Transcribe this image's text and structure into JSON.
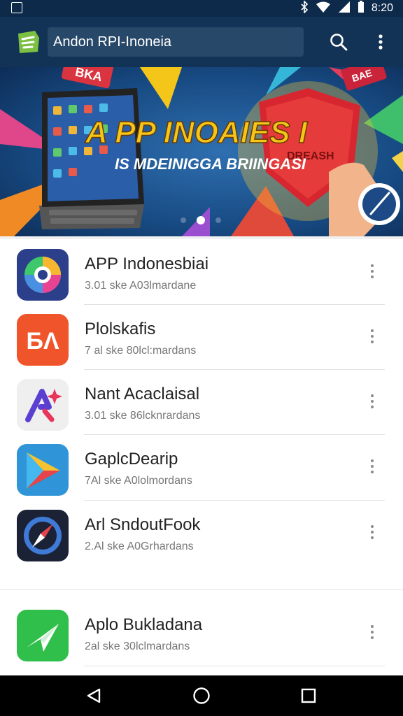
{
  "status": {
    "time": "8:20"
  },
  "appbar": {
    "search_text": "Andon RPI-Inoneia"
  },
  "banner": {
    "headline": "A PP INOAIES I",
    "subline": "IS MDEINIGGA BRIINGASI",
    "shield_text": "DREASH",
    "corner_text": "BKA",
    "corner_text_right": "BAE"
  },
  "apps": [
    {
      "title": "APP Indonesbiai",
      "subtitle": "3.01 ske A03lmardane",
      "icon": "color-wheel-icon"
    },
    {
      "title": "Plolskafis",
      "subtitle": "7 al ske 80lcl:mardans",
      "icon": "ba-logo-icon"
    },
    {
      "title": "Nant Acaclaisal",
      "subtitle": "3.01 ske 86lcknrardans",
      "icon": "a-sparkle-icon"
    },
    {
      "title": "GaplcDearip",
      "subtitle": "7Al ske A0lolmordans",
      "icon": "play-triangle-icon"
    },
    {
      "title": "Arl SndoutFook",
      "subtitle": "2.Al ske A0Grhardans",
      "icon": "compass-icon"
    },
    {
      "title": "Aplo Bukladana",
      "subtitle": "2al ske 30lclmardans",
      "icon": "paper-plane-icon"
    }
  ],
  "colors": {
    "appbar": "#123356",
    "statusbar": "#0e2a4a",
    "accent_green": "#7bc043"
  }
}
